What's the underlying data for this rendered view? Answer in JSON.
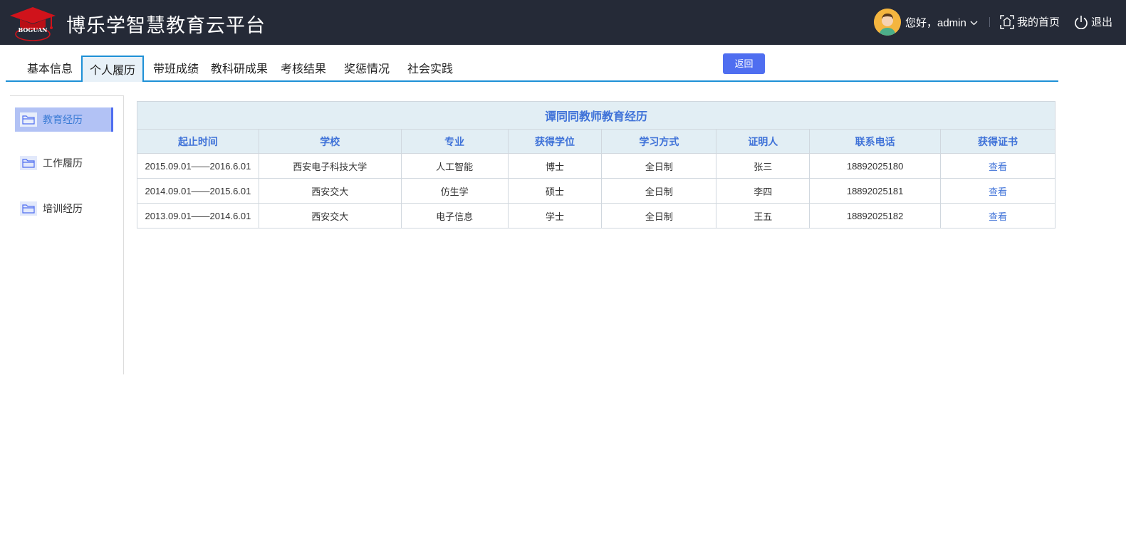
{
  "header": {
    "app_title": "博乐学智慧教育云平台",
    "logo_text": "BOGUAN",
    "greeting": "您好，admin",
    "home_label": "我的首页",
    "logout_label": "退出"
  },
  "tabs": [
    {
      "label": "基本信息",
      "active": false
    },
    {
      "label": "个人履历",
      "active": true
    },
    {
      "label": "带班成绩",
      "active": false
    },
    {
      "label": "教科研成果",
      "active": false
    },
    {
      "label": "考核结果",
      "active": false
    },
    {
      "label": "奖惩情况",
      "active": false
    },
    {
      "label": "社会实践",
      "active": false
    }
  ],
  "back_button": "返回",
  "sidebar": {
    "items": [
      {
        "label": "教育经历",
        "active": true
      },
      {
        "label": "工作履历",
        "active": false
      },
      {
        "label": "培训经历",
        "active": false
      }
    ]
  },
  "table": {
    "caption": "谭同同教师教育经历",
    "columns": [
      "起止时间",
      "学校",
      "专业",
      "获得学位",
      "学习方式",
      "证明人",
      "联系电话",
      "获得证书"
    ],
    "rows": [
      [
        "2015.09.01——2016.6.01",
        "西安电子科技大学",
        "人工智能",
        "博士",
        "全日制",
        "张三",
        "18892025180",
        "查看"
      ],
      [
        "2014.09.01——2015.6.01",
        "西安交大",
        "仿生学",
        "硕士",
        "全日制",
        "李四",
        "18892025181",
        "查看"
      ],
      [
        "2013.09.01——2014.6.01",
        "西安交大",
        "电子信息",
        "学士",
        "全日制",
        "王五",
        "18892025182",
        "查看"
      ]
    ]
  },
  "colors": {
    "header_bg": "#252a37",
    "accent": "#1e90d6",
    "button": "#4f6ef0",
    "table_header_text": "#3f72d8"
  }
}
